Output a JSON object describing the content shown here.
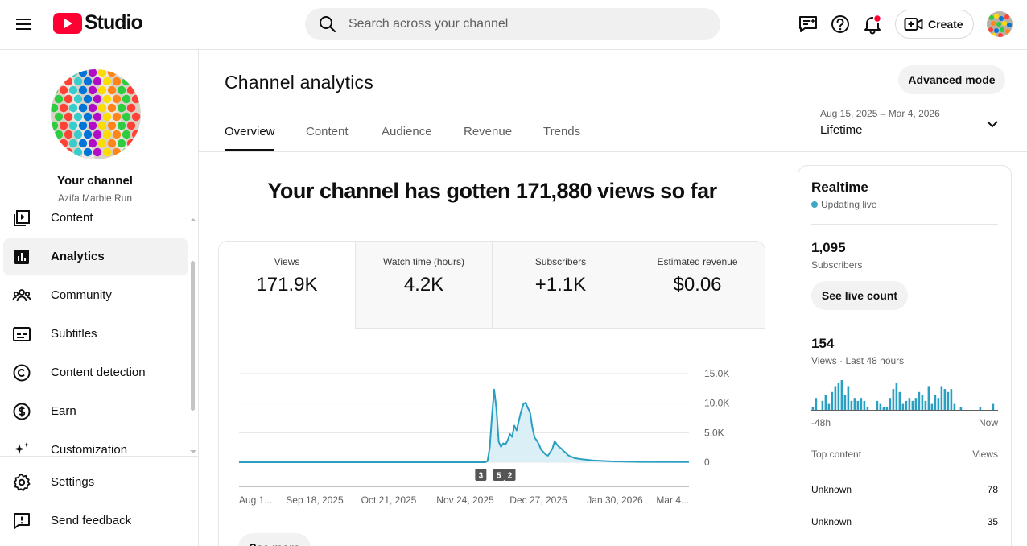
{
  "header": {
    "logo_text": "Studio",
    "search_placeholder": "Search across your channel",
    "create_label": "Create"
  },
  "sidebar": {
    "channel_title": "Your channel",
    "channel_handle": "Azifa Marble Run",
    "items": [
      {
        "label": "Content",
        "icon": "content-icon"
      },
      {
        "label": "Analytics",
        "icon": "analytics-icon",
        "active": true
      },
      {
        "label": "Community",
        "icon": "community-icon"
      },
      {
        "label": "Subtitles",
        "icon": "subtitles-icon"
      },
      {
        "label": "Content detection",
        "icon": "copyright-icon"
      },
      {
        "label": "Earn",
        "icon": "dollar-icon"
      },
      {
        "label": "Customization",
        "icon": "sparkle-icon"
      }
    ],
    "bottom_items": [
      {
        "label": "Settings",
        "icon": "gear-icon"
      },
      {
        "label": "Send feedback",
        "icon": "feedback-icon"
      }
    ]
  },
  "main": {
    "title": "Channel analytics",
    "advanced_mode_label": "Advanced mode",
    "tabs": [
      "Overview",
      "Content",
      "Audience",
      "Revenue",
      "Trends"
    ],
    "active_tab": "Overview",
    "date_range": "Aug 15, 2025 – Mar 4, 2026",
    "date_label": "Lifetime",
    "headline": "Your channel has gotten 171,880 views so far",
    "metrics": [
      {
        "label": "Views",
        "value": "171.9K"
      },
      {
        "label": "Watch time (hours)",
        "value": "4.2K"
      },
      {
        "label": "Subscribers",
        "value": "+1.1K"
      },
      {
        "label": "Estimated revenue",
        "value": "$0.06"
      }
    ],
    "see_more_label": "See more"
  },
  "chart_data": {
    "type": "area",
    "x_tick_labels": [
      "Aug 1...",
      "Sep 18, 2025",
      "Oct 21, 2025",
      "Nov 24, 2025",
      "Dec 27, 2025",
      "Jan 30, 2026",
      "Mar 4..."
    ],
    "y_tick_labels": [
      "15.0K",
      "10.0K",
      "5.0K",
      "0"
    ],
    "ylim": [
      0,
      15000
    ],
    "x_start": "2025-08-15",
    "x_end": "2026-03-04",
    "color": "#2a9fc2",
    "fill": "#dbeff6",
    "points": [
      [
        "2025-08-15",
        0
      ],
      [
        "2025-09-18",
        0
      ],
      [
        "2025-10-21",
        0
      ],
      [
        "2025-11-24",
        0
      ],
      [
        "2025-12-03",
        0
      ],
      [
        "2025-12-04",
        200
      ],
      [
        "2025-12-05",
        2500
      ],
      [
        "2025-12-06",
        8000
      ],
      [
        "2025-12-07",
        12300
      ],
      [
        "2025-12-08",
        9000
      ],
      [
        "2025-12-09",
        3500
      ],
      [
        "2025-12-10",
        2600
      ],
      [
        "2025-12-11",
        3200
      ],
      [
        "2025-12-12",
        3000
      ],
      [
        "2025-12-13",
        3700
      ],
      [
        "2025-12-14",
        4800
      ],
      [
        "2025-12-15",
        4300
      ],
      [
        "2025-12-16",
        6200
      ],
      [
        "2025-12-17",
        5400
      ],
      [
        "2025-12-18",
        7000
      ],
      [
        "2025-12-19",
        8600
      ],
      [
        "2025-12-20",
        9800
      ],
      [
        "2025-12-21",
        10100
      ],
      [
        "2025-12-22",
        9200
      ],
      [
        "2025-12-23",
        8500
      ],
      [
        "2025-12-24",
        6000
      ],
      [
        "2025-12-25",
        4200
      ],
      [
        "2025-12-26",
        3700
      ],
      [
        "2025-12-27",
        3000
      ],
      [
        "2025-12-28",
        2100
      ],
      [
        "2025-12-29",
        1700
      ],
      [
        "2025-12-30",
        1300
      ],
      [
        "2025-12-31",
        1100
      ],
      [
        "2026-01-01",
        1700
      ],
      [
        "2026-01-02",
        2300
      ],
      [
        "2026-01-03",
        3600
      ],
      [
        "2026-01-04",
        3000
      ],
      [
        "2026-01-05",
        2600
      ],
      [
        "2026-01-06",
        2300
      ],
      [
        "2026-01-07",
        1900
      ],
      [
        "2026-01-08",
        1600
      ],
      [
        "2026-01-09",
        1200
      ],
      [
        "2026-01-10",
        1000
      ],
      [
        "2026-01-12",
        700
      ],
      [
        "2026-01-15",
        500
      ],
      [
        "2026-01-20",
        300
      ],
      [
        "2026-01-28",
        150
      ],
      [
        "2026-02-10",
        60
      ],
      [
        "2026-03-04",
        40
      ]
    ],
    "annotations": [
      {
        "date": "2025-12-01",
        "label": "3"
      },
      {
        "date": "2025-12-09",
        "label": "5"
      },
      {
        "date": "2025-12-14",
        "label": "2"
      }
    ]
  },
  "realtime": {
    "title": "Realtime",
    "status": "Updating live",
    "subscribers_value": "1,095",
    "subscribers_label": "Subscribers",
    "live_count_label": "See live count",
    "views_value": "154",
    "views_label": "Views · Last 48 hours",
    "axis_start": "-48h",
    "axis_end": "Now",
    "bar_color": "#2a9fc2",
    "bars": [
      1,
      4,
      0,
      3,
      5,
      2,
      6,
      8,
      9,
      10,
      5,
      8,
      3,
      4,
      3,
      4,
      3,
      1,
      0,
      0,
      3,
      2,
      1,
      1,
      4,
      7,
      9,
      6,
      2,
      3,
      4,
      3,
      4,
      6,
      5,
      3,
      8,
      2,
      5,
      4,
      8,
      7,
      6,
      7,
      2,
      0,
      1,
      0,
      0,
      0,
      0,
      0,
      1,
      0,
      0,
      0,
      2,
      0
    ],
    "top_content_label": "Top content",
    "top_content_views_label": "Views",
    "top_content": [
      {
        "title": "Unknown",
        "views": "78"
      },
      {
        "title": "Unknown",
        "views": "35"
      }
    ]
  }
}
